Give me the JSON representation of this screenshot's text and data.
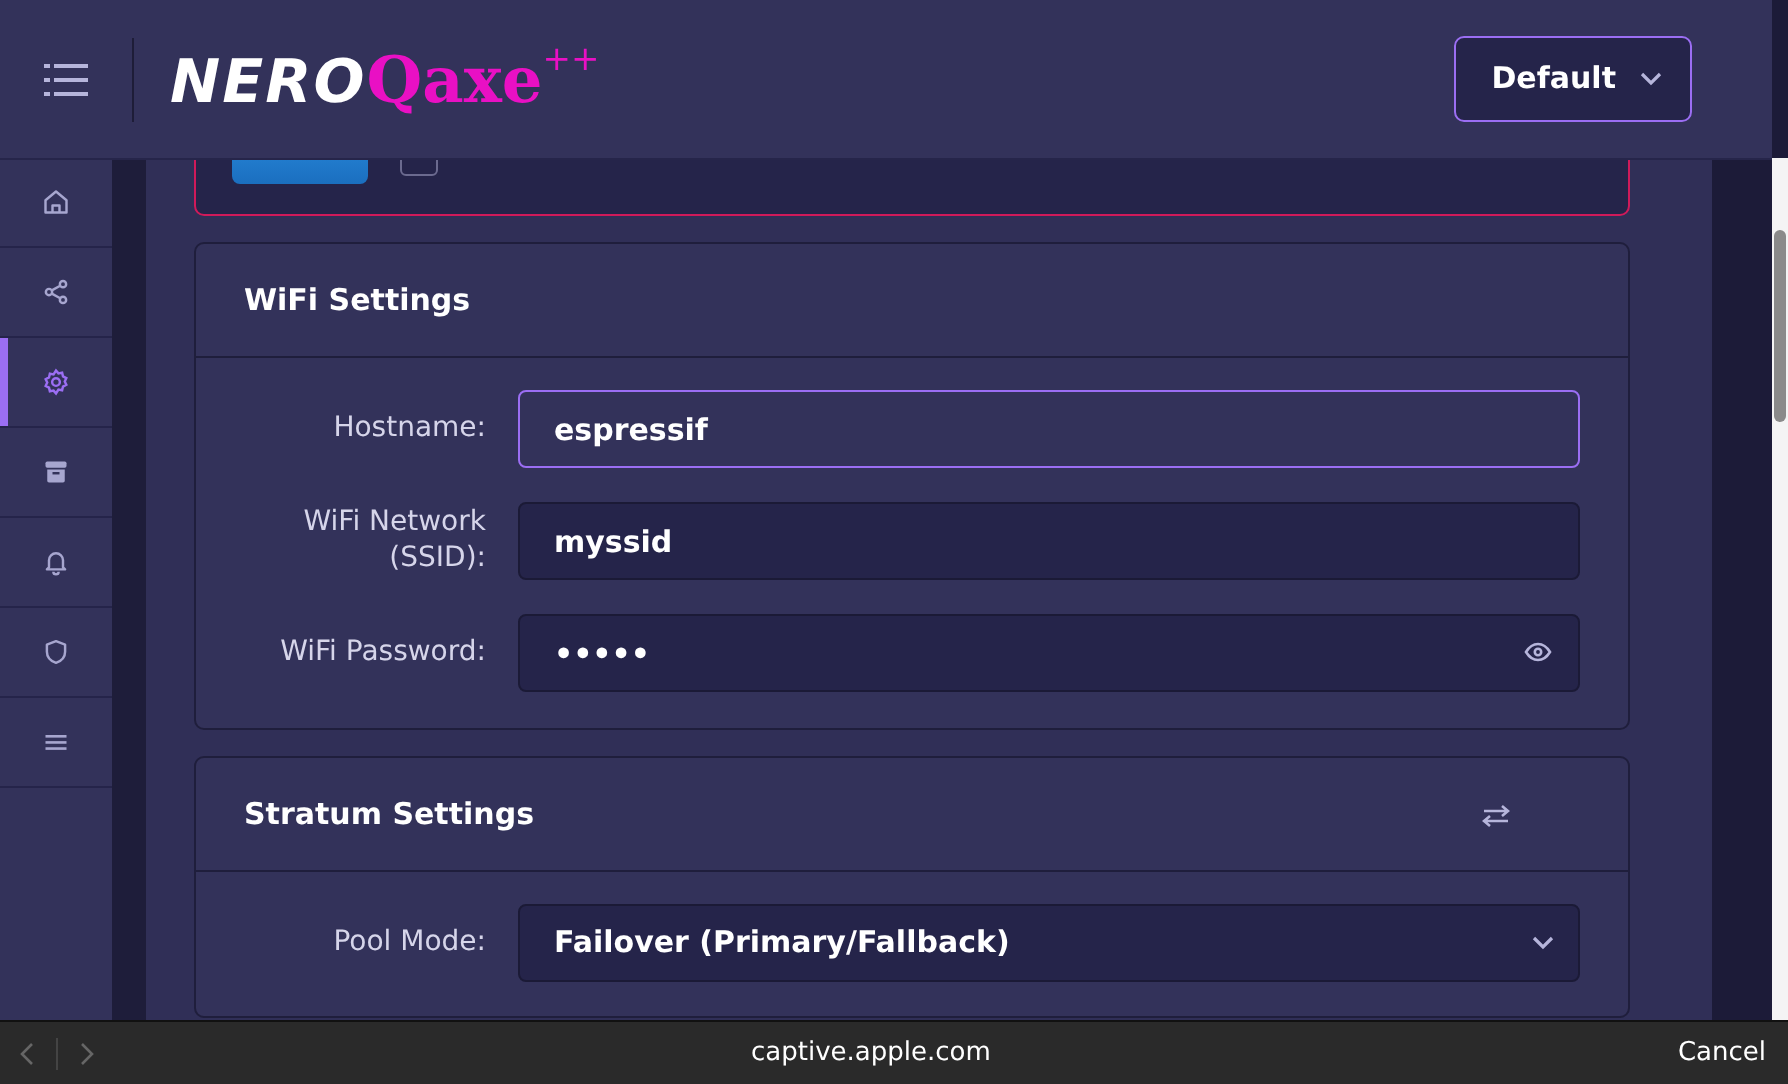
{
  "header": {
    "logo": {
      "first": "NERO",
      "second": "Qaxe",
      "sup": "++"
    },
    "theme_select": {
      "value": "Default"
    }
  },
  "sidebar": {
    "items": [
      {
        "selected": false
      },
      {
        "selected": false
      },
      {
        "selected": true
      },
      {
        "selected": false
      },
      {
        "selected": false
      },
      {
        "selected": false
      },
      {
        "selected": false
      }
    ]
  },
  "notice": {
    "checkbox": {
      "checked": false
    }
  },
  "wifi": {
    "title": "WiFi Settings",
    "fields": [
      {
        "label": "Hostname:",
        "value": "espressif",
        "kind": "text",
        "focused": true
      },
      {
        "label": "WiFi Network (SSID):",
        "value": "myssid",
        "kind": "text",
        "focused": false
      },
      {
        "label": "WiFi Password:",
        "value": "•••••",
        "kind": "password",
        "focused": false
      }
    ]
  },
  "stratum": {
    "title": "Stratum Settings",
    "fields": [
      {
        "label": "Pool Mode:",
        "value": "Failover (Primary/Fallback)",
        "kind": "select"
      }
    ]
  },
  "browser_bar": {
    "url": "captive.apple.com",
    "cancel": "Cancel"
  }
}
